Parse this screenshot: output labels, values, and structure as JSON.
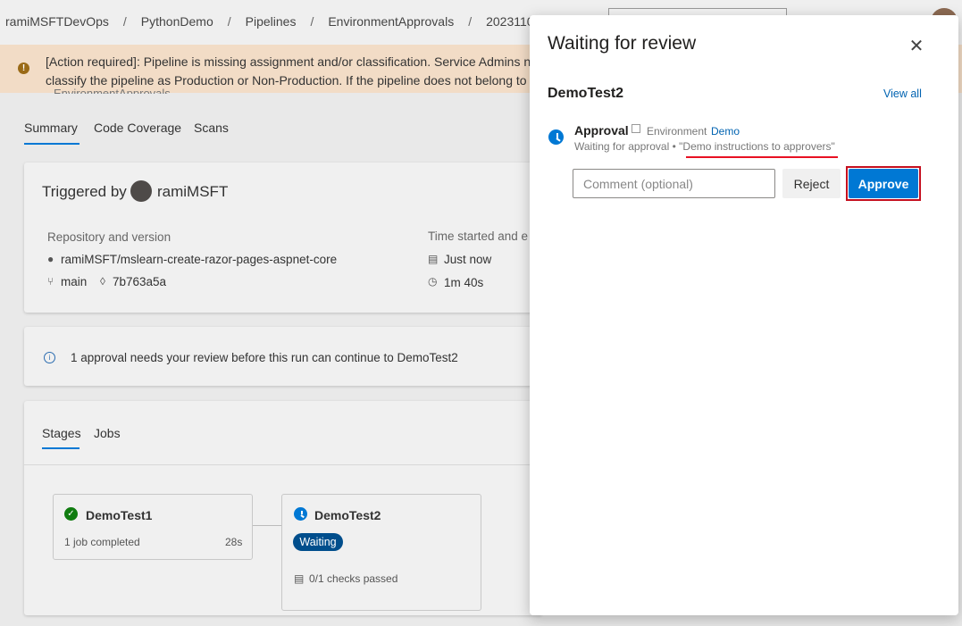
{
  "breadcrumb": {
    "items": [
      "ramiMSFTDevOps",
      "PythonDemo",
      "Pipelines",
      "EnvironmentApprovals",
      "2023110"
    ],
    "separator": "/"
  },
  "warning": {
    "line1": "[Action required]: Pipeline is missing assignment and/or classification. Service Admins ne",
    "line2": "classify the pipeline as Production or Non-Production. If the pipeline does not belong to"
  },
  "pipeline_label": "EnvironmentApprovals",
  "tabs": [
    "Summary",
    "Code Coverage",
    "Scans"
  ],
  "summary": {
    "triggered_prefix": "Triggered by",
    "user": "ramiMSFT",
    "repo_label": "Repository and version",
    "repo": "ramiMSFT/mslearn-create-razor-pages-aspnet-core",
    "branch": "main",
    "commit": "7b763a5a",
    "time_label": "Time started and e",
    "started": "Just now",
    "duration": "1m 40s"
  },
  "notice": "1 approval needs your review before this run can continue to DemoTest2",
  "stages_tabs": [
    "Stages",
    "Jobs"
  ],
  "stages": [
    {
      "name": "DemoTest1",
      "detail": "1 job completed",
      "time": "28s"
    },
    {
      "name": "DemoTest2",
      "badge": "Waiting",
      "checks": "0/1 checks passed"
    }
  ],
  "panel": {
    "title": "Waiting for review",
    "close_glyph": "✕",
    "stage": "DemoTest2",
    "view_all": "View all",
    "approval_title": "Approval",
    "env_label": "Environment",
    "env_name": "Demo",
    "status_prefix": "Waiting for approval •",
    "instructions": "\"Demo instructions to approvers\"",
    "comment_placeholder": "Comment (optional)",
    "reject_label": "Reject",
    "approve_label": "Approve"
  },
  "colors": {
    "accent": "#0078d4",
    "success": "#107c10",
    "highlight": "#e81123",
    "waiting_badge": "#004e8c"
  }
}
